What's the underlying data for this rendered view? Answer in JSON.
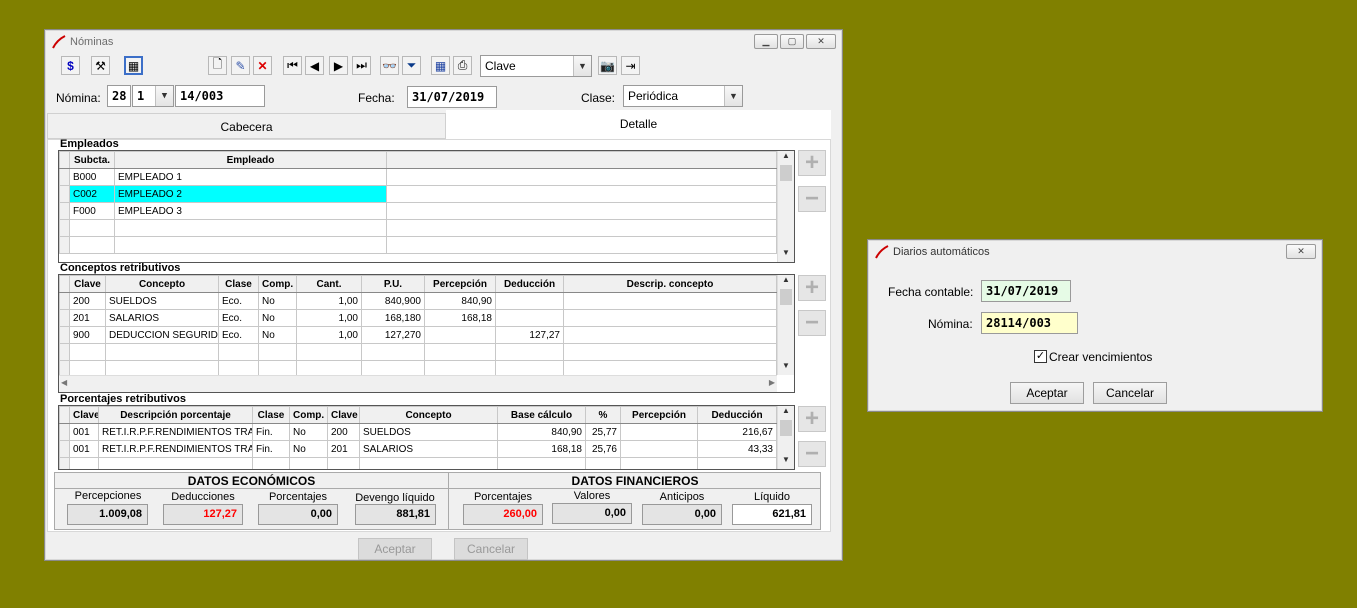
{
  "main": {
    "title": "Nóminas",
    "toolbar": {
      "clave_value": "Clave"
    },
    "nomina": {
      "label": "Nómina:",
      "a": "28",
      "b": "1",
      "c": "14/003"
    },
    "fecha": {
      "label": "Fecha:",
      "value": "31/07/2019"
    },
    "clase": {
      "label": "Clase:",
      "value": "Periódica"
    },
    "tabs": [
      "Cabecera",
      "Detalle"
    ],
    "empleados": {
      "title": "Empleados",
      "headers": [
        "Subcta.",
        "Empleado"
      ],
      "rows": [
        [
          "B000",
          "EMPLEADO 1"
        ],
        [
          "C002",
          "EMPLEADO 2"
        ],
        [
          "F000",
          "EMPLEADO 3"
        ]
      ]
    },
    "conceptos": {
      "title": "Conceptos retributivos",
      "headers": [
        "Clave",
        "Concepto",
        "Clase",
        "Comp.",
        "Cant.",
        "P.U.",
        "Percepción",
        "Deducción",
        "Descrip. concepto"
      ],
      "rows": [
        [
          "200",
          "SUELDOS",
          "Eco.",
          "No",
          "1,00",
          "840,900",
          "840,90",
          ""
        ],
        [
          "201",
          "SALARIOS",
          "Eco.",
          "No",
          "1,00",
          "168,180",
          "168,18",
          ""
        ],
        [
          "900",
          "DEDUCCION SEGURIDAD",
          "Eco.",
          "No",
          "1,00",
          "127,270",
          "",
          "127,27"
        ]
      ]
    },
    "porcentajes": {
      "title": "Porcentajes retributivos",
      "headers": [
        "Clave",
        "Descripción porcentaje",
        "Clase",
        "Comp.",
        "Clave",
        "Concepto",
        "Base cálculo",
        "%",
        "Percepción",
        "Deducción"
      ],
      "rows": [
        [
          "001",
          "RET.I.R.P.F.RENDIMIENTOS TRA",
          "Fin.",
          "No",
          "200",
          "SUELDOS",
          "840,90",
          "25,77",
          "",
          "216,67"
        ],
        [
          "001",
          "RET.I.R.P.F.RENDIMIENTOS TRA",
          "Fin.",
          "No",
          "201",
          "SALARIOS",
          "168,18",
          "25,76",
          "",
          "43,33"
        ]
      ]
    },
    "economicos": {
      "title": "DATOS ECONÓMICOS",
      "labels": [
        "Percepciones",
        "Deducciones",
        "Porcentajes",
        "Devengo líquido"
      ],
      "values": [
        "1.009,08",
        "127,27",
        "0,00",
        "881,81"
      ]
    },
    "financieros": {
      "title": "DATOS FINANCIEROS",
      "labels": [
        "Porcentajes",
        "Valores",
        "Anticipos",
        "Líquido"
      ],
      "values": [
        "260,00",
        "0,00",
        "0,00",
        "621,81"
      ]
    },
    "buttons": {
      "accept": "Aceptar",
      "cancel": "Cancelar"
    }
  },
  "dialog": {
    "title": "Diarios automáticos",
    "fecha_label": "Fecha contable:",
    "fecha_value": "31/07/2019",
    "nomina_label": "Nómina:",
    "nomina_value": "28114/003",
    "checkbox_label": "Crear vencimientos",
    "checkbox_checked": true,
    "accept": "Aceptar",
    "cancel": "Cancelar"
  },
  "colors": {
    "desktop": "#808000",
    "selection": "#00ffff",
    "negative": "#ff0000"
  }
}
